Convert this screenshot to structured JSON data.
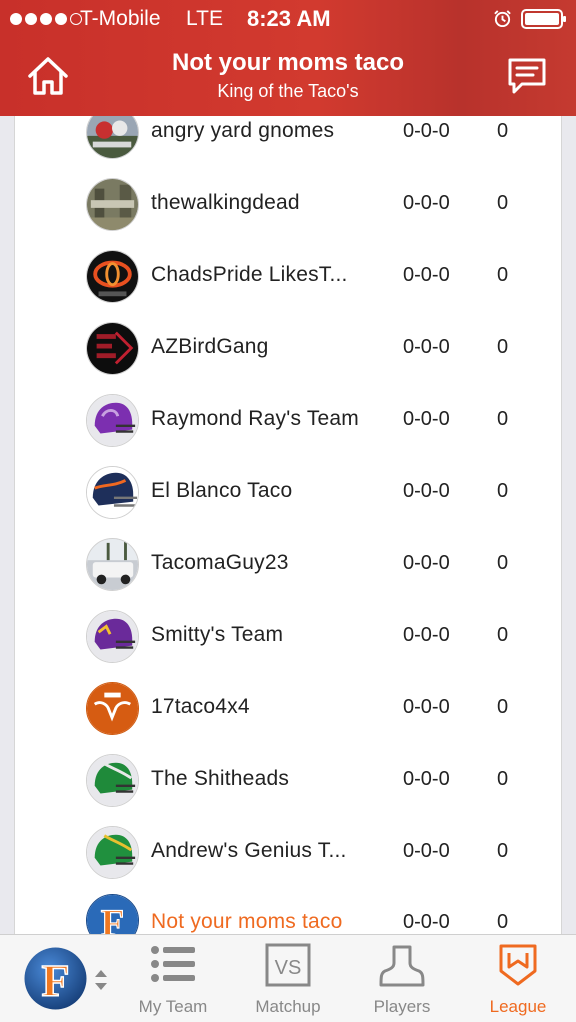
{
  "status_bar": {
    "carrier": "T-Mobile",
    "network": "LTE",
    "time": "8:23 AM",
    "signal_dots_filled": 4,
    "signal_dots_total": 5
  },
  "nav": {
    "title": "Not your moms taco",
    "subtitle": "King of the Taco's",
    "home_icon": "home-icon",
    "chat_icon": "chat-bubble-icon"
  },
  "teams": [
    {
      "name": "angry yard gnomes",
      "record": "0-0-0",
      "points": "0",
      "avatar": "gnomes-photo"
    },
    {
      "name": "thewalkingdead",
      "record": "0-0-0",
      "points": "0",
      "avatar": "walking-dead-photo"
    },
    {
      "name": "ChadsPride LikesT...",
      "record": "0-0-0",
      "points": "0",
      "avatar": "toyota-logo"
    },
    {
      "name": "AZBirdGang",
      "record": "0-0-0",
      "points": "0",
      "avatar": "bird-gang-logo"
    },
    {
      "name": "Raymond Ray's Team",
      "record": "0-0-0",
      "points": "0",
      "avatar": "purple-helmet"
    },
    {
      "name": "El Blanco Taco",
      "record": "0-0-0",
      "points": "0",
      "avatar": "broncos-helmet"
    },
    {
      "name": "TacomaGuy23",
      "record": "0-0-0",
      "points": "0",
      "avatar": "truck-photo"
    },
    {
      "name": "Smitty's Team",
      "record": "0-0-0",
      "points": "0",
      "avatar": "vikings-helmet"
    },
    {
      "name": "17taco4x4",
      "record": "0-0-0",
      "points": "0",
      "avatar": "texas-longhorn-logo"
    },
    {
      "name": "The Shitheads",
      "record": "0-0-0",
      "points": "0",
      "avatar": "green-helmet"
    },
    {
      "name": "Andrew's Genius T...",
      "record": "0-0-0",
      "points": "0",
      "avatar": "green-gold-helmet"
    },
    {
      "name": "Not your moms taco",
      "record": "0-0-0",
      "points": "0",
      "avatar": "f-logo",
      "is_user": true
    }
  ],
  "tab_bar": {
    "tabs": [
      {
        "label": "My Team",
        "icon": "list-icon",
        "active": false
      },
      {
        "label": "Matchup",
        "icon": "vs-icon",
        "active": false
      },
      {
        "label": "Players",
        "icon": "player-icon",
        "active": false
      },
      {
        "label": "League",
        "icon": "league-shield-icon",
        "active": true
      }
    ],
    "team_logo_letter": "F"
  },
  "colors": {
    "brand_red": "#cc3a2e",
    "accent_orange": "#ef6a20",
    "tab_inactive": "#888888"
  }
}
